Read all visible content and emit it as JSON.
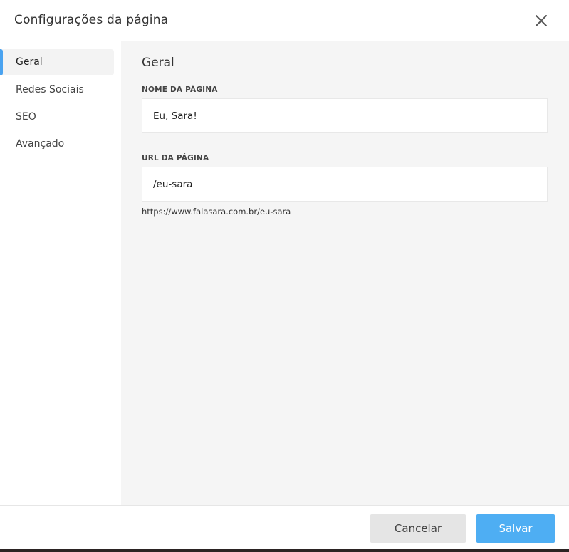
{
  "header": {
    "title": "Configurações da página",
    "close_icon": "close-icon"
  },
  "sidebar": {
    "items": [
      {
        "label": "Geral",
        "active": true
      },
      {
        "label": "Redes Sociais",
        "active": false
      },
      {
        "label": "SEO",
        "active": false
      },
      {
        "label": "Avançado",
        "active": false
      }
    ],
    "accent_color": "#4aa3f0"
  },
  "main": {
    "section_title": "Geral",
    "page_name": {
      "label": "NOME DA PÁGINA",
      "value": "Eu, Sara!"
    },
    "page_url": {
      "label": "URL DA PÁGINA",
      "value": "/eu-sara",
      "full_url": "https://www.falasara.com.br/eu-sara"
    }
  },
  "footer": {
    "cancel_label": "Cancelar",
    "save_label": "Salvar",
    "save_color": "#4eaef3"
  }
}
